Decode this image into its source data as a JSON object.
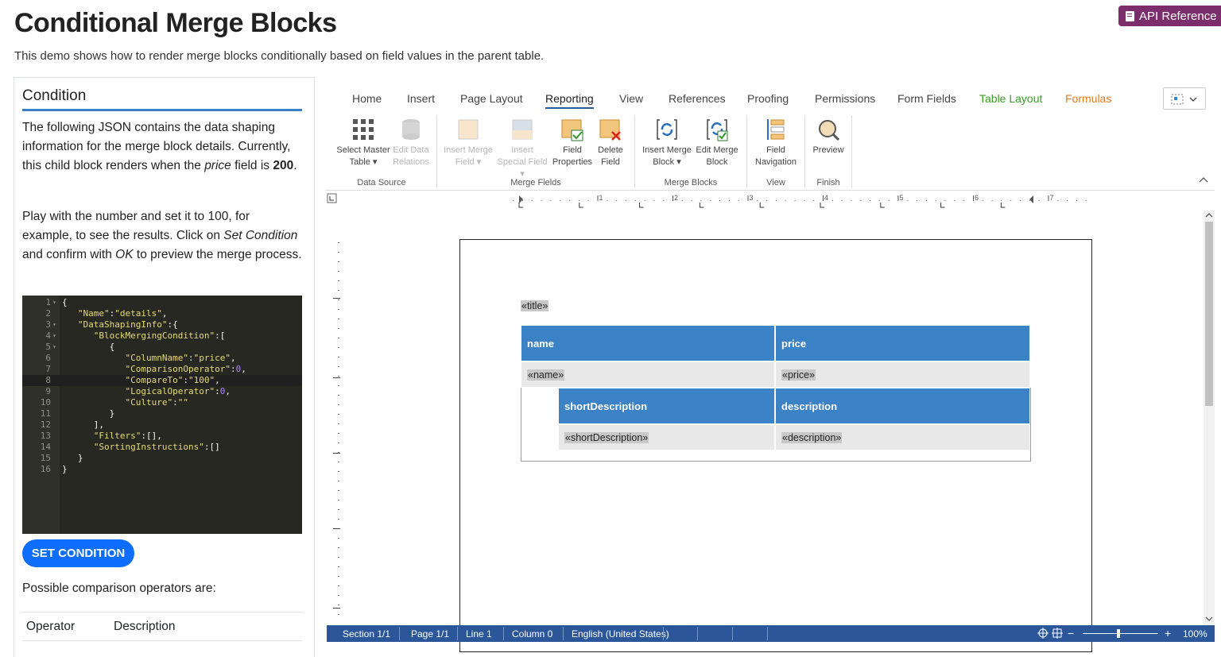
{
  "header": {
    "title": "Conditional Merge Blocks",
    "subtitle": "This demo shows how to render merge blocks conditionally based on field values in the parent table.",
    "api_button": "API Reference"
  },
  "condition": {
    "title": "Condition",
    "p1_a": "The following JSON contains the data shaping information for the merge block details. Currently, this child block renders when the ",
    "p1_em": "price",
    "p1_b": " field is ",
    "p1_strong": "200",
    "p1_c": ".",
    "p2_a": "Play with the number and set it to 100, for example, to see the results. Click on ",
    "p2_em1": "Set Condition",
    "p2_b": " and confirm with ",
    "p2_em2": "OK",
    "p2_c": " to preview the merge process.",
    "set_button": "SET CONDITION",
    "operators_text": "Possible comparison operators are:",
    "table_headers": [
      "Operator",
      "Description"
    ]
  },
  "code_lines": [
    {
      "n": "1",
      "fold": true,
      "text": "{"
    },
    {
      "n": "2",
      "fold": false,
      "text": "   \"Name\":\"details\","
    },
    {
      "n": "3",
      "fold": true,
      "text": "   \"DataShapingInfo\":{"
    },
    {
      "n": "4",
      "fold": true,
      "text": "      \"BlockMergingCondition\":["
    },
    {
      "n": "5",
      "fold": true,
      "text": "         {"
    },
    {
      "n": "6",
      "fold": false,
      "text": "            \"ColumnName\":\"price\","
    },
    {
      "n": "7",
      "fold": false,
      "text": "            \"ComparisonOperator\":0,"
    },
    {
      "n": "8",
      "fold": false,
      "text": "            \"CompareTo\":\"100\","
    },
    {
      "n": "9",
      "fold": false,
      "text": "            \"LogicalOperator\":0,"
    },
    {
      "n": "10",
      "fold": false,
      "text": "            \"Culture\":\"\""
    },
    {
      "n": "11",
      "fold": false,
      "text": "         }"
    },
    {
      "n": "12",
      "fold": false,
      "text": "      ],"
    },
    {
      "n": "13",
      "fold": false,
      "text": "      \"Filters\":[],"
    },
    {
      "n": "14",
      "fold": false,
      "text": "      \"SortingInstructions\":[]"
    },
    {
      "n": "15",
      "fold": false,
      "text": "   }"
    },
    {
      "n": "16",
      "fold": false,
      "text": "}"
    }
  ],
  "ribbon": {
    "tabs": [
      "Home",
      "Insert",
      "Page Layout",
      "Reporting",
      "View",
      "References",
      "Proofing",
      "Permissions",
      "Form Fields",
      "Table Layout",
      "Formulas"
    ],
    "active_tab": "Reporting",
    "buttons": {
      "select_master": "Select Master Table ▾",
      "edit_relations": "Edit Data Relations",
      "insert_merge_field": "Insert Merge Field ▾",
      "insert_special": "Insert Special Field ▾",
      "field_properties": "Field Properties",
      "delete_field": "Delete Field",
      "insert_block": "Insert Merge Block ▾",
      "edit_block": "Edit Merge Block",
      "field_navigation": "Field Navigation",
      "preview": "Preview"
    },
    "groups": [
      "Data Source",
      "Merge Fields",
      "Merge Blocks",
      "View",
      "Finish"
    ],
    "colors": {
      "table_layout": "#3a9d23",
      "formulas": "#e07b1f"
    }
  },
  "document": {
    "title_field": "«title»",
    "headers": [
      "name",
      "price"
    ],
    "fields": [
      "«name»",
      "«price»"
    ],
    "sub_headers": [
      "shortDescription",
      "description"
    ],
    "sub_fields": [
      "«shortDescription»",
      "«description»"
    ]
  },
  "ruler": {
    "marks": [
      "1",
      "2",
      "3",
      "4",
      "5",
      "6",
      "7"
    ]
  },
  "status": {
    "section": "Section 1/1",
    "page": "Page 1/1",
    "line": "Line 1",
    "column": "Column 0",
    "language": "English (United States)",
    "zoom": "100%",
    "zoom_level": 1.0
  }
}
